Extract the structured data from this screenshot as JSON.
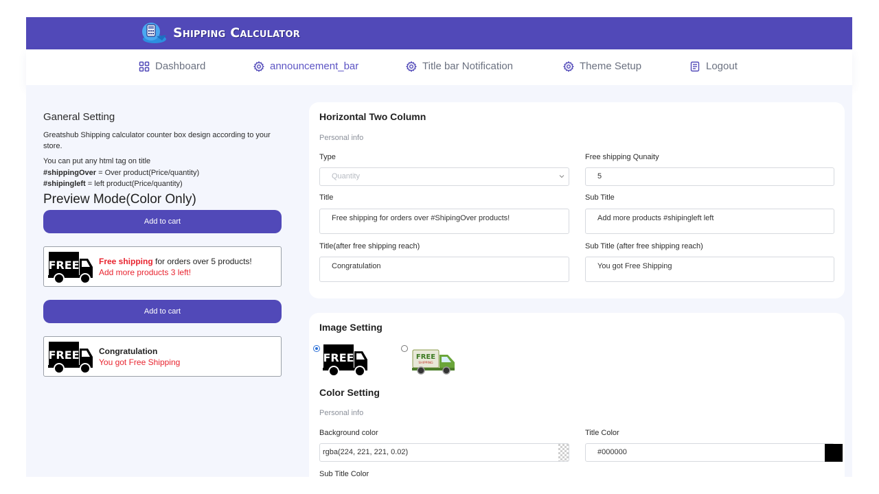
{
  "header": {
    "app_title": "Shipping Calculator"
  },
  "nav": [
    {
      "label": "Dashboard",
      "icon": "grid-icon"
    },
    {
      "label": "announcement_bar",
      "icon": "gear-icon"
    },
    {
      "label": "Title bar Notification",
      "icon": "gear-icon"
    },
    {
      "label": "Theme Setup",
      "icon": "gear-icon"
    },
    {
      "label": "Logout",
      "icon": "document-icon"
    }
  ],
  "left": {
    "title": "Ganeral Setting",
    "description": "Greatshub Shipping calculator counter box design according to your store.",
    "html_note": "You can put any html tag on title",
    "var1_name": "#shippingOver",
    "var1_desc": " = Over product(Price/quantity)",
    "var2_name": "#shipingleft",
    "var2_desc": " = left product(Price/quantity)",
    "preview_title": "Preview Mode(Color Only)",
    "add_to_cart": "Add to cart",
    "preview1": {
      "red_part": "Free shipping",
      "rest": " for orders over 5 products!",
      "subtitle": "Add more products 3 left!"
    },
    "preview2": {
      "title": "Congratulation",
      "subtitle": "You got Free Shipping"
    }
  },
  "form": {
    "title": "Horizontal Two Column",
    "section": "Personal info",
    "type_label": "Type",
    "type_value": "Quantity",
    "free_qty_label": "Free shipping Qunaity",
    "free_qty_value": "5",
    "title_label": "Title",
    "title_value": "Free shipping for orders over #ShipingOver products!",
    "subtitle_label": "Sub Title",
    "subtitle_value": "Add more products #shipingleft left",
    "title_after_label": "Title(after free shipping reach)",
    "title_after_value": "Congratulation",
    "subtitle_after_label": "Sub Title (after free shipping reach)",
    "subtitle_after_value": "You got Free Shipping"
  },
  "image_setting": {
    "title": "Image Setting",
    "option1": "FREE",
    "option2": "FREE",
    "option2_small": "SHIPPING"
  },
  "color_setting": {
    "title": "Color Setting",
    "section": "Personal info",
    "bg_label": "Background color",
    "bg_value": "rgba(224, 221, 221, 0.02)",
    "title_color_label": "Title Color",
    "title_color_value": "#000000",
    "subtitle_color_label": "Sub Title Color"
  },
  "colors": {
    "brand": "#5149b8",
    "red": "#e8242f",
    "bg": "#f4f6fd"
  }
}
